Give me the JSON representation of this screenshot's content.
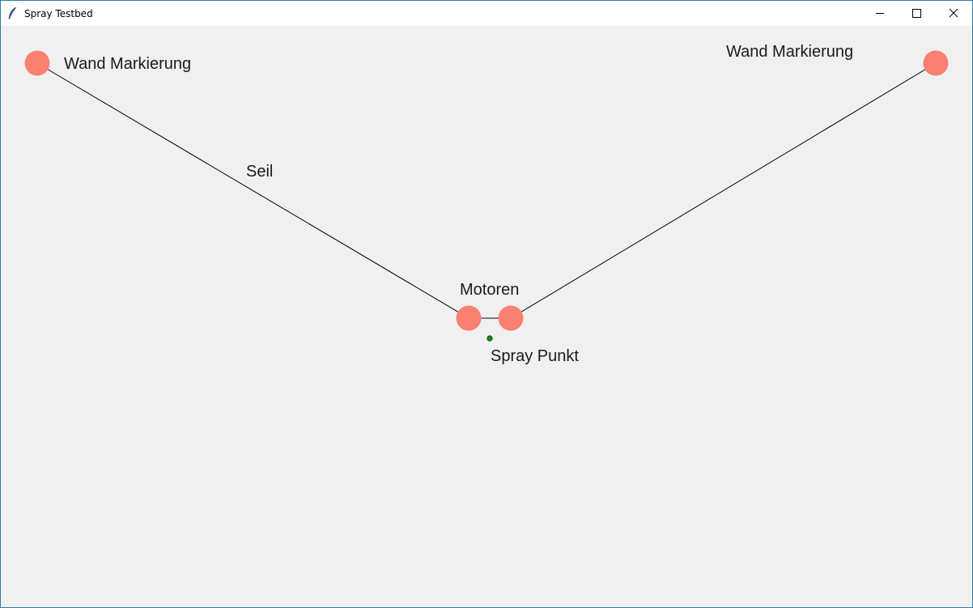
{
  "window": {
    "title": "Spray Testbed",
    "icons": {
      "app": "feather-icon",
      "minimize": "minimize-icon",
      "maximize": "maximize-icon",
      "close": "close-icon"
    }
  },
  "canvas": {
    "labels": {
      "wall_left": "Wand Markierung",
      "wall_right": "Wand Markierung",
      "rope": "Seil",
      "motors": "Motoren",
      "spray_point": "Spray Punkt"
    },
    "colors": {
      "background": "#f0f0f0",
      "marker": "#fa8072",
      "rope": "#000000",
      "spray_point": "#1a8a1a"
    }
  }
}
